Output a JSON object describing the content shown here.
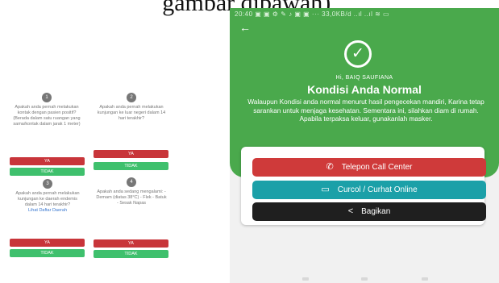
{
  "caption": "gambar dibawah),",
  "left": {
    "questions": [
      {
        "num": "1",
        "text": "Apakah anda pernah melakukan kontak dengan pasien positif? (Berada dalam satu ruangan yang sama/kontak dalam jarak 1 meter)"
      },
      {
        "num": "2",
        "text": "Apakah anda pernah melakukan kunjungan ke luar negeri dalam 14 hari terakhir?"
      },
      {
        "num": "3",
        "text": "Apakah anda pernah melakukan kunjungan ke daerah endemis dalam 14 hari terakhir?",
        "link": "Lihat Daftar Daerah"
      },
      {
        "num": "4",
        "text": "Apakah anda sedang mengalami: - Demam (diatas 38°C) - Flek - Batuk - Sesak Napas"
      }
    ],
    "ya_label": "YA",
    "tidak_label": "TIDAK"
  },
  "phone": {
    "status": "20:40 ▣ ▣ ⚙ ✎ ♪ ▣ ▣ ··· 33,0KB/d ..ıl ..ıl ≋ ▭",
    "back_glyph": "←",
    "greeting": "Hi, BAIQ SAUFIANA",
    "title": "Kondisi Anda Normal",
    "message": "Walaupun Kondisi anda normal menurut hasil pengecekan mandiri, Karina tetap sarankan untuk menjaga kesehatan. Sementara ini, silahkan diam di rumah. Apabila terpaksa keluar, gunakanlah masker.",
    "buttons": {
      "call": {
        "label": "Telepon Call Center",
        "color": "#cf3a3a",
        "icon": "phone-icon"
      },
      "curhat": {
        "label": "Curcol / Curhat Online",
        "color": "#1ba0a8",
        "icon": "chat-icon"
      },
      "share": {
        "label": "Bagikan",
        "color": "#1f1f1f",
        "icon": "share-icon"
      }
    },
    "accent_green": "#4aa94c"
  }
}
